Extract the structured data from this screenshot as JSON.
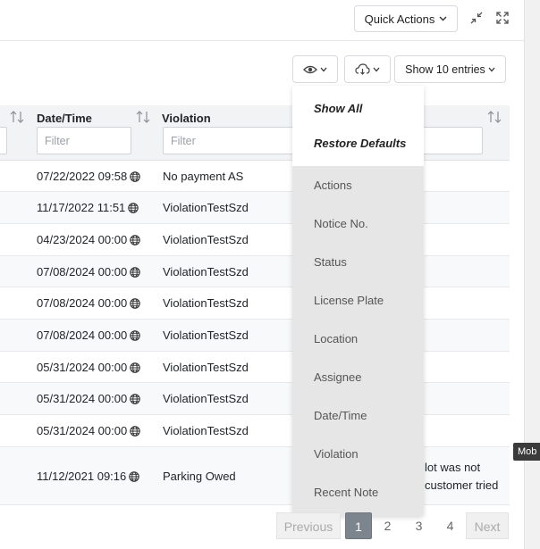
{
  "header": {
    "quick_actions_label": "Quick Actions",
    "icons": [
      "chevron-down-icon",
      "collapse-icon",
      "expand-icon"
    ]
  },
  "toolbar": {
    "visibility_icon": "eye-icon",
    "export_icon": "cloud-download-icon",
    "show_entries_label": "Show 10 entries"
  },
  "table": {
    "columns": [
      {
        "label": "Date/Time",
        "filter_placeholder": "Filter"
      },
      {
        "label": "Violation",
        "filter_placeholder": "Filter"
      }
    ],
    "rows": [
      {
        "datetime": "07/22/2022 09:58",
        "violation": "No payment AS",
        "note": ""
      },
      {
        "datetime": "11/17/2022 11:51",
        "violation": "ViolationTestSzd",
        "note": ""
      },
      {
        "datetime": "04/23/2024 00:00",
        "violation": "ViolationTestSzd",
        "note": ""
      },
      {
        "datetime": "07/08/2024 00:00",
        "violation": "ViolationTestSzd",
        "note": ""
      },
      {
        "datetime": "07/08/2024 00:00",
        "violation": "ViolationTestSzd",
        "note": ""
      },
      {
        "datetime": "07/08/2024 00:00",
        "violation": "ViolationTestSzd",
        "note": ""
      },
      {
        "datetime": "05/31/2024 00:00",
        "violation": "ViolationTestSzd",
        "note": ""
      },
      {
        "datetime": "05/31/2024 00:00",
        "violation": "ViolationTestSzd",
        "note": ""
      },
      {
        "datetime": "05/31/2024 00:00",
        "violation": "ViolationTestSzd",
        "note": ""
      },
      {
        "datetime": "11/12/2021 09:16",
        "violation": "Parking Owed",
        "note_line1": "lot was not",
        "note_line2": "customer tried"
      }
    ]
  },
  "column_menu": {
    "show_all": "Show All",
    "restore_defaults": "Restore Defaults",
    "items": [
      "Actions",
      "Notice No.",
      "Status",
      "License Plate",
      "Location",
      "Assignee",
      "Date/Time",
      "Violation",
      "Recent Note"
    ]
  },
  "pagination": {
    "previous": "Previous",
    "pages": [
      "1",
      "2",
      "3",
      "4"
    ],
    "current": "1",
    "next": "Next"
  },
  "side_tag": "Mob",
  "colors": {
    "header_bg": "#f2f3f5",
    "menu_bg": "#e6e6e6",
    "active_page": "#7c848d"
  }
}
